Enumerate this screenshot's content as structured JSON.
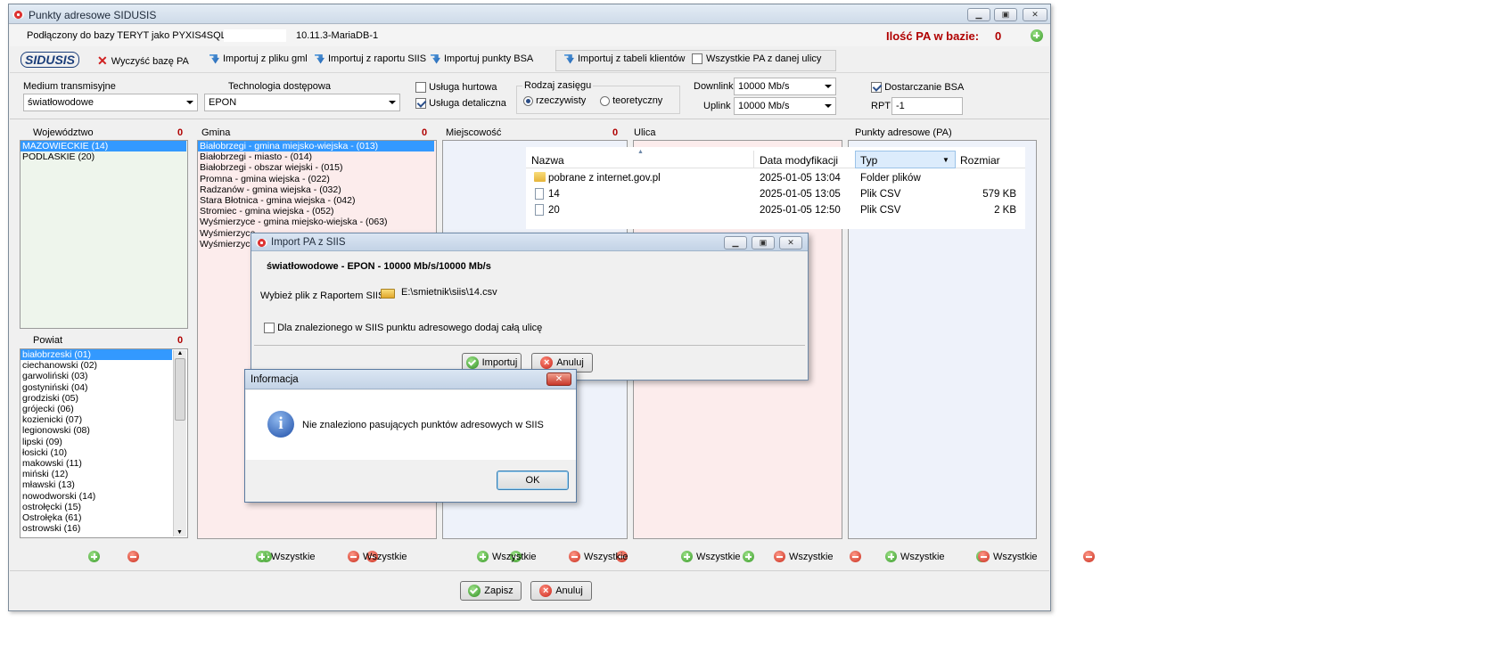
{
  "window": {
    "title": "Punkty adresowe SIDUSIS"
  },
  "status": {
    "connection": "Podłączony do bazy TERYT jako PYXIS4SQL@",
    "version": "10.11.3-MariaDB-1",
    "pa_label": "Ilość PA w bazie:",
    "pa_count": "0"
  },
  "toolbar": {
    "logo": "SIDUSIS",
    "clear": "Wyczyść bazę PA",
    "import_gml": "Importuj z pliku gml",
    "import_siis": "Importuj z raportu SIIS",
    "import_bsa": "Importuj punkty BSA",
    "import_clients": "Importuj z tabeli klientów",
    "all_street": "Wszystkie PA z danej ulicy"
  },
  "filters": {
    "medium_label": "Medium transmisyjne",
    "medium_value": "światłowodowe",
    "tech_label": "Technologia dostępowa",
    "tech_value": "EPON",
    "wholesale": "Usługa hurtowa",
    "retail": "Usługa detaliczna",
    "range_label": "Rodzaj zasięgu",
    "range_real": "rzeczywisty",
    "range_theory": "teoretyczny",
    "downlink_label": "Downlink",
    "downlink_value": "10000 Mb/s",
    "uplink_label": "Uplink",
    "uplink_value": "10000 Mb/s",
    "bsa_label": "Dostarczanie BSA",
    "rpt_label": "RPT",
    "rpt_value": "-1"
  },
  "panels": {
    "voiv_label": "Województwo",
    "voiv_count": "0",
    "voiv": [
      "MAZOWIECKIE (14)",
      "PODLASKIE (20)"
    ],
    "powiat_label": "Powiat",
    "powiat_count": "0",
    "powiat": [
      "białobrzeski (01)",
      "ciechanowski (02)",
      "garwoliński (03)",
      "gostyniński (04)",
      "grodziski (05)",
      "grójecki (06)",
      "kozienicki (07)",
      "legionowski (08)",
      "lipski (09)",
      "łosicki (10)",
      "makowski (11)",
      "miński (12)",
      "mławski (13)",
      "nowodworski (14)",
      "ostrołęcki (15)",
      "Ostrołęka (61)",
      "ostrowski (16)"
    ],
    "gmina_label": "Gmina",
    "gmina_count": "0",
    "gmina": [
      "Białobrzegi - gmina miejsko-wiejska - (013)",
      "Białobrzegi - miasto - (014)",
      "Białobrzegi - obszar wiejski - (015)",
      "Promna - gmina wiejska - (022)",
      "Radzanów - gmina wiejska - (032)",
      "Stara Błotnica - gmina wiejska - (042)",
      "Stromiec - gmina wiejska - (052)",
      "Wyśmierzyce - gmina miejsko-wiejska - (063)",
      "Wyśmierzyce",
      "Wyśmierzyce"
    ],
    "miejsc_label": "Miejscowość",
    "miejsc_count": "0",
    "ulica_label": "Ulica",
    "pa_label": "Punkty adresowe (PA)",
    "all": "Wszystkie"
  },
  "filelist": {
    "headers": [
      "Nazwa",
      "Data modyfikacji",
      "Typ",
      "Rozmiar"
    ],
    "rows": [
      [
        "pobrane z internet.gov.pl",
        "2025-01-05 13:04",
        "Folder plików",
        ""
      ],
      [
        "14",
        "2025-01-05 13:05",
        "Plik CSV",
        "579 KB"
      ],
      [
        "20",
        "2025-01-05 12:50",
        "Plik CSV",
        "2 KB"
      ]
    ]
  },
  "import_dialog": {
    "title": "Import PA z SIIS",
    "heading": "światłowodowe - EPON - 10000 Mb/s/10000 Mb/s",
    "file_label": "Wybież plik z Raportem SIIS",
    "file_path": "E:\\smietnik\\siis\\14.csv",
    "checkbox": "Dla znalezionego w SIIS punktu adresowego dodaj całą ulicę",
    "import_btn": "Importuj",
    "cancel_btn": "Anuluj"
  },
  "info_dialog": {
    "title": "Informacja",
    "message": "Nie znaleziono pasujących punktów adresowych w SIIS",
    "ok": "OK"
  },
  "footer": {
    "save": "Zapisz",
    "cancel": "Anuluj"
  }
}
